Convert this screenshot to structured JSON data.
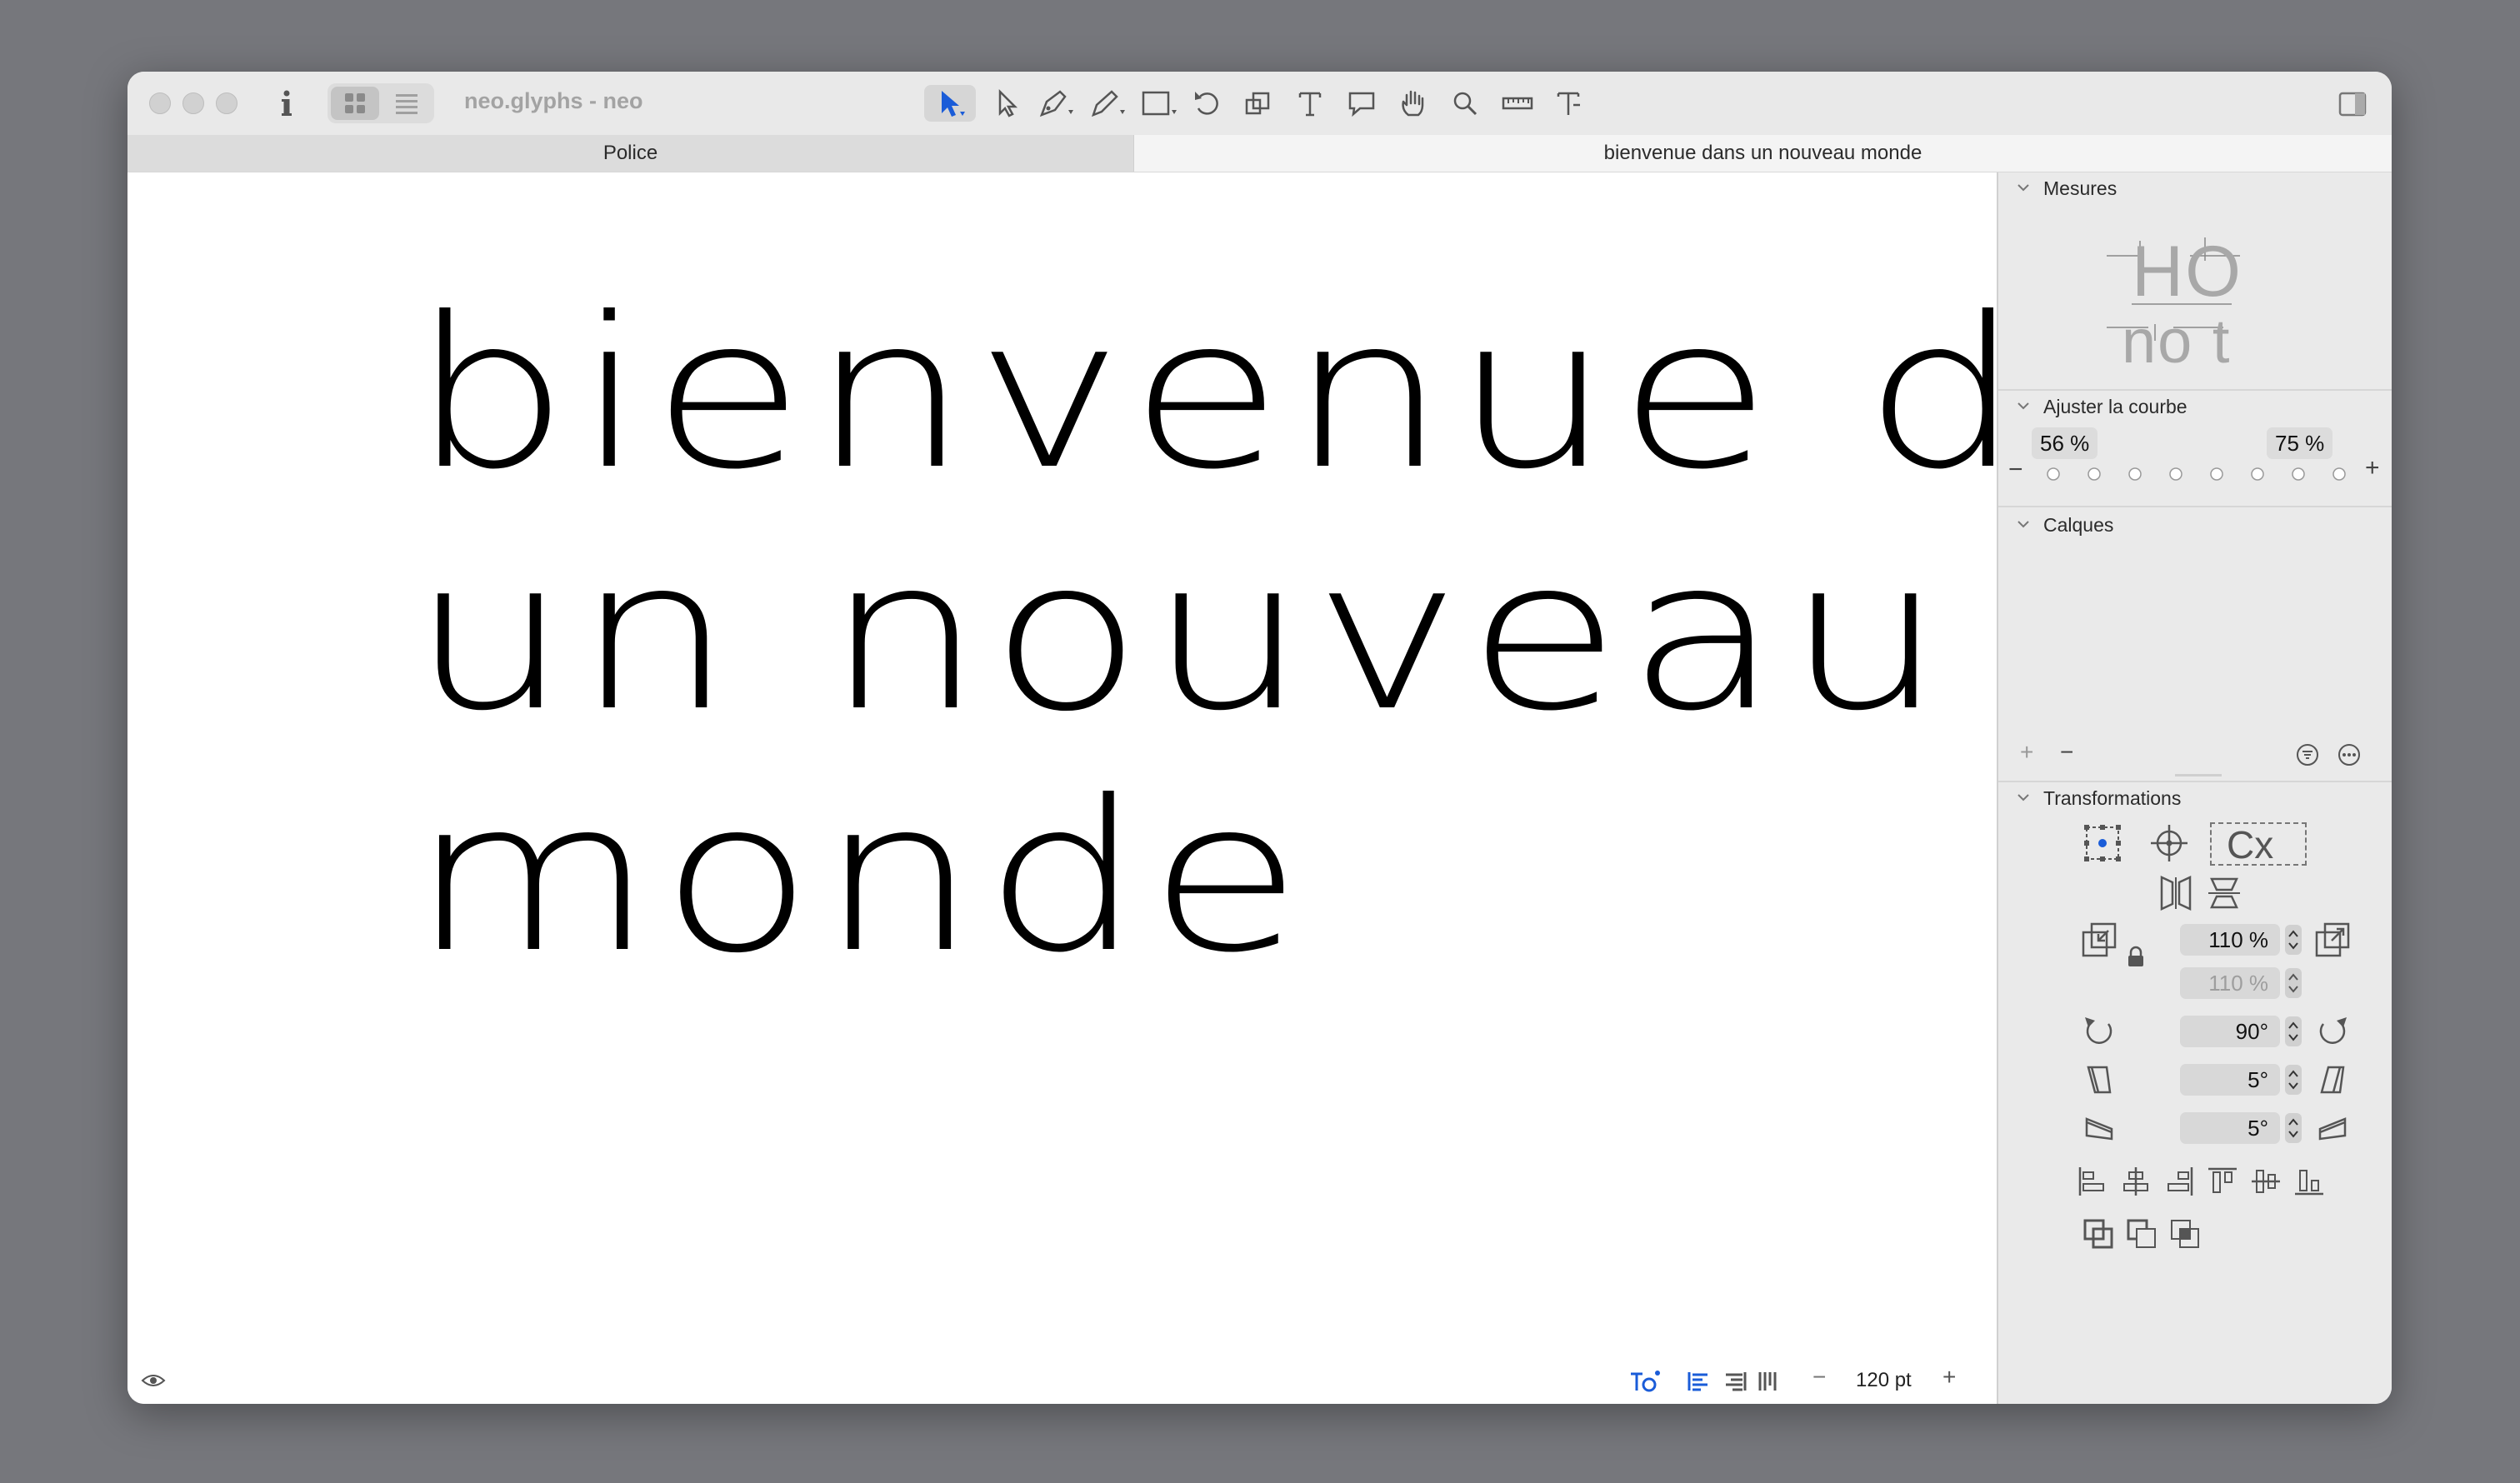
{
  "window": {
    "title": "neo.glyphs - neo"
  },
  "tabs": [
    {
      "label": "Police"
    },
    {
      "label": "bienvenue dans un nouveau monde"
    }
  ],
  "canvas": {
    "lines": [
      "bienvenue dans",
      "un nouveau",
      "monde"
    ]
  },
  "statusbar": {
    "font_size": "120 pt",
    "zoom_out": "−",
    "zoom_in": "+"
  },
  "inspector": {
    "mesures": {
      "title": "Mesures",
      "row1": "HO",
      "row2": "no t"
    },
    "curve": {
      "title": "Ajuster la courbe",
      "left_value": "56 %",
      "right_value": "75 %",
      "minus": "−",
      "plus": "+"
    },
    "layers": {
      "title": "Calques",
      "add": "+",
      "remove": "−"
    },
    "transform": {
      "title": "Transformations",
      "scale_x": "110 %",
      "scale_y": "110 %",
      "rotate": "90°",
      "slant_x": "5°",
      "slant_y": "5°",
      "cx_label": "Cx"
    }
  },
  "colors": {
    "accent": "#1a5cd8",
    "chrome": "#e9e9e9",
    "backdrop": "#76777c"
  }
}
